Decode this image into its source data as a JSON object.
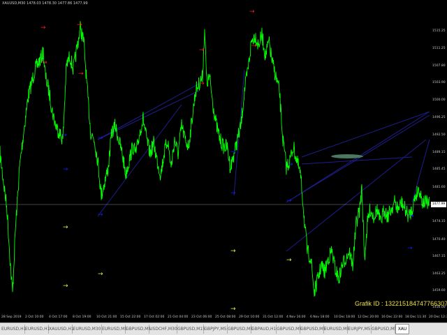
{
  "chart": {
    "symbol_info": "XAUUSD,M30  1478.03 1478.30 1477.86 1477.99",
    "grafik_id": "Grafik ID : 13221518474776630 7",
    "current_price": "1477.99",
    "price_ticks": [
      "1515.25",
      "1511.25",
      "1507.80",
      "1503.90",
      "1500.00",
      "1496.25",
      "1492.50",
      "1489.15",
      "1485.45",
      "1481.60",
      "1477.99",
      "1474.15",
      "1470.40",
      "1467.15",
      "1463.25",
      "1459.60",
      "1456.00"
    ],
    "time_ticks": [
      "28 Sep 2019",
      "2 Oct 10:00",
      "4 Oct 17:00",
      "8 Oct 19:00",
      "10 Oct 21:00",
      "15 Oct 22:00",
      "17 Oct 02:00",
      "21 Oct 04:00",
      "23 Oct 06:00",
      "25 Oct 08:00",
      "29 Oct 10:00",
      "31 Oct 12:00",
      "4 Nov 16:00",
      "6 Nov 18:00",
      "10 Dec 18:00",
      "12 Dec 20:00",
      "16 Dec 22:00",
      "18 Dec 11:30",
      "20 Dec 12:30"
    ],
    "colors": {
      "price_line": "#00ff00",
      "up_arrow": "#ff2020",
      "down_arrow": "#1a1aff",
      "yellow_arrow": "#f0f040",
      "trend_line": "#1e1e8c",
      "ellipse": "#4a7a60"
    }
  },
  "tabs": [
    {
      "label": "EURUSD,H1",
      "active": false
    },
    {
      "label": "EURUSD,H1",
      "active": false
    },
    {
      "label": "XAUUSD,H1",
      "active": false
    },
    {
      "label": "EURUSD,M30",
      "active": false
    },
    {
      "label": "EURUSD,M5",
      "active": false
    },
    {
      "label": "GBPUSD,M5",
      "active": false
    },
    {
      "label": "USDCHF,M30",
      "active": false
    },
    {
      "label": "GBPUSD,M15",
      "active": false
    },
    {
      "label": "GBPJPY,M5",
      "active": false
    },
    {
      "label": "GBPUSD,M5",
      "active": false
    },
    {
      "label": "GBPAUD,H1",
      "active": false
    },
    {
      "label": "GBPUSD,M5",
      "active": false
    },
    {
      "label": "GBPUSD,M5",
      "active": false
    },
    {
      "label": "EURUSD,M5",
      "active": false
    },
    {
      "label": "EURJPY,M5",
      "active": false
    },
    {
      "label": "GBPUSD,M5",
      "active": false
    },
    {
      "label": "XAU",
      "active": true
    }
  ]
}
